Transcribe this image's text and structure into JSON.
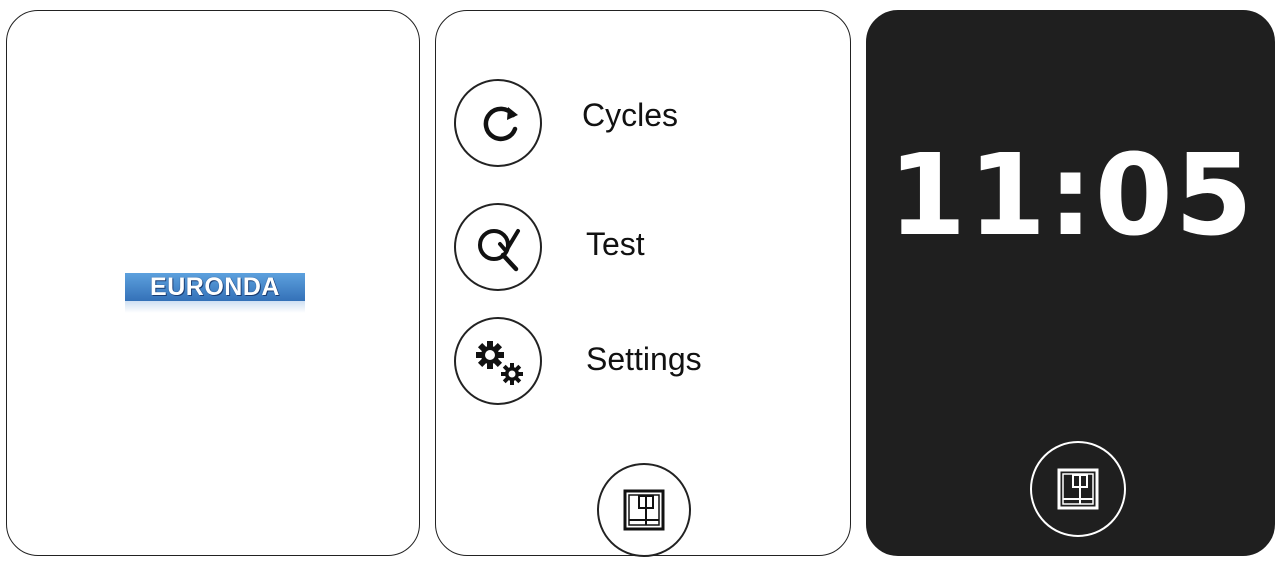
{
  "splash": {
    "logo_text": "EURONDA",
    "brand_color": "#3f7fc4"
  },
  "menu": {
    "items": [
      {
        "label": "Cycles",
        "icon": "refresh-icon"
      },
      {
        "label": "Test",
        "icon": "search-check-icon"
      },
      {
        "label": "Settings",
        "icon": "gears-icon"
      }
    ],
    "door_button_icon": "door-icon"
  },
  "clock": {
    "time": "11:05",
    "background_color": "#1f1f1f",
    "door_button_icon": "door-icon"
  }
}
